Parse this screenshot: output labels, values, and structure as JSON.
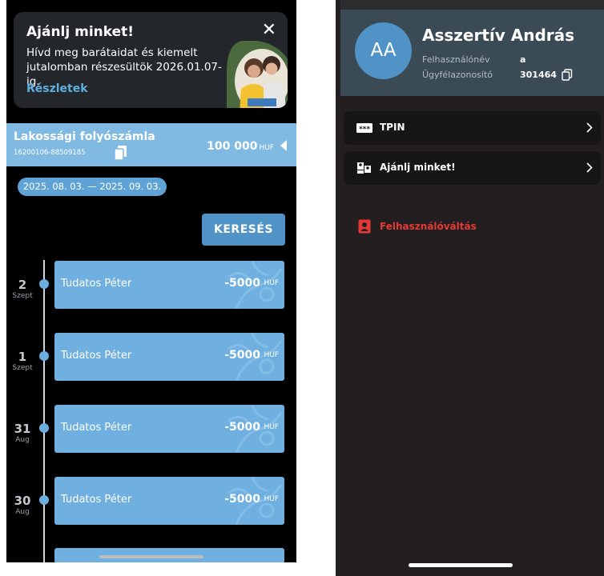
{
  "promo": {
    "title": "Ajánlj minket!",
    "text": "Hívd meg barátaidat és kiemelt jutalomban részesültök 2026.01.07-ig.",
    "link": "Részletek",
    "close_symbol": "✕"
  },
  "account": {
    "name": "Lakossági folyószámla",
    "number": "16200106-88509185",
    "balance": "100 000",
    "currency": "HUF",
    "copy_icon": "copy-icon",
    "arrow_icon": "triangle-left-icon"
  },
  "filter": {
    "date_range": "2025. 08. 03. — 2025. 09. 03.",
    "search_label": "KERESÉS"
  },
  "transactions": [
    {
      "day": "2",
      "month": "Szept",
      "name": "Tudatos Péter",
      "amount": "-5000",
      "currency": "HUF"
    },
    {
      "day": "1",
      "month": "Szept",
      "name": "Tudatos Péter",
      "amount": "-5000",
      "currency": "HUF"
    },
    {
      "day": "31",
      "month": "Aug",
      "name": "Tudatos Péter",
      "amount": "-5000",
      "currency": "HUF"
    },
    {
      "day": "30",
      "month": "Aug",
      "name": "Tudatos Péter",
      "amount": "-5000",
      "currency": "HUF"
    }
  ],
  "profile": {
    "initials": "AA",
    "name": "Asszertív András",
    "username_label": "Felhasználónév",
    "username_value": "a",
    "client_id_label": "Ügyfélazonosító",
    "client_id_value": "301464"
  },
  "menu": {
    "tpin_label": "TPIN",
    "refer_label": "Ajánlj minket!",
    "switch_user_label": "Felhasználóváltás"
  },
  "colors": {
    "accent_blue": "#6fb0e0",
    "account_bar": "#80b9e1",
    "danger_red": "#e53935",
    "profile_header": "#3b4b56",
    "right_background": "#231f20"
  }
}
